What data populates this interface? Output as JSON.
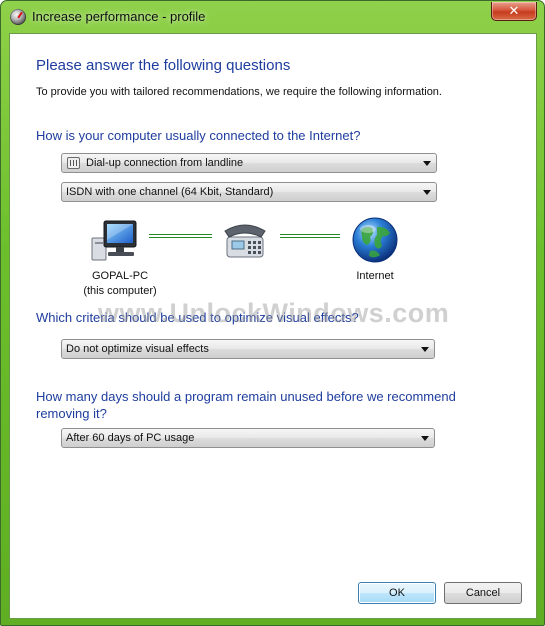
{
  "window": {
    "title": "Increase performance - profile",
    "close_glyph": "✕"
  },
  "heading": "Please answer the following questions",
  "description": "To provide you with tailored recommendations, we require the following information.",
  "connection": {
    "question": "How is your computer usually connected to the Internet?",
    "type_value": "Dial-up connection from landline",
    "speed_value": "ISDN with one channel (64 Kbit, Standard)"
  },
  "network": {
    "computer_name": "GOPAL-PC",
    "computer_sub": "(this computer)",
    "internet_label": "Internet",
    "icons": [
      "computer-icon",
      "telephone-modem-icon",
      "globe-icon"
    ],
    "link_color": "#1f8a1f"
  },
  "watermark": "www.UnlockWindows.com",
  "visual": {
    "question": "Which criteria should be used to optimize visual effects?",
    "value": "Do not optimize visual effects"
  },
  "unused": {
    "question_line1": "How many days should a program remain unused before we recommend",
    "question_line2": "removing it?",
    "value": "After 60 days of PC usage"
  },
  "buttons": {
    "ok": "OK",
    "cancel": "Cancel"
  },
  "colors": {
    "heading": "#1e3d9e",
    "title_bar": "#6cbf2c",
    "default_button": "#3c7fb1"
  }
}
